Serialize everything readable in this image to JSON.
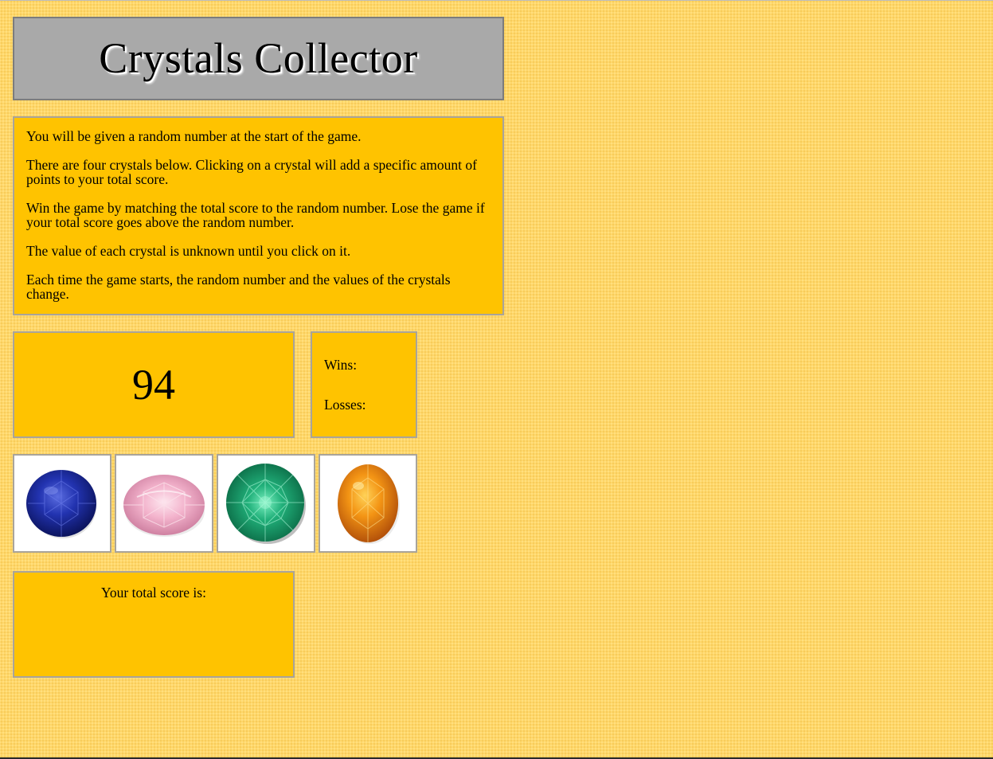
{
  "header": {
    "title": "Crystals Collector"
  },
  "instructions": [
    "You will be given a random number at the start of the game.",
    "There are four crystals below. Clicking on a crystal will add a specific amount of points to your total score.",
    "Win the game by matching the total score to the random number. Lose the game if your total score goes above the random number.",
    "The value of each crystal is unknown until you click on it.",
    "Each time the game starts, the random number and the values of the crystals change."
  ],
  "target": {
    "number": "94"
  },
  "record": {
    "wins_label": "Wins:",
    "wins_value": "",
    "losses_label": "Losses:",
    "losses_value": ""
  },
  "crystals": [
    {
      "name": "blue-sapphire-icon",
      "color": "#1e2fa8"
    },
    {
      "name": "pink-gem-icon",
      "color": "#f1a9c7"
    },
    {
      "name": "green-emerald-icon",
      "color": "#1fa873"
    },
    {
      "name": "orange-citrine-icon",
      "color": "#f08a12"
    }
  ],
  "score": {
    "label": "Your total score is:",
    "value": ""
  },
  "colors": {
    "background": "#ffd76a",
    "panel": "#ffc300",
    "title_panel": "#a9a9a9",
    "border": "#a9a49a"
  }
}
